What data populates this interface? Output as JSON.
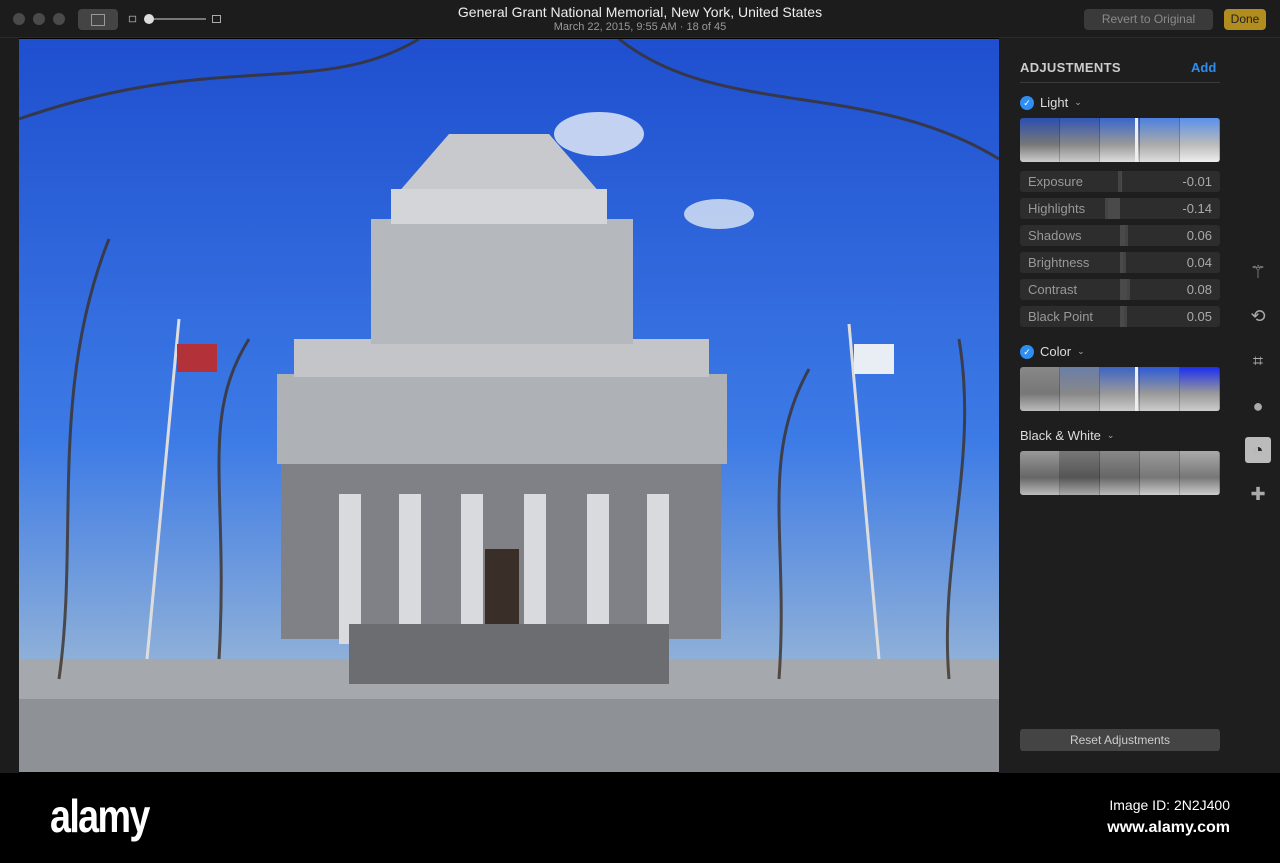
{
  "window": {
    "title": "General Grant National Memorial, New York, United States",
    "subtitle": "March 22, 2015, 9:55 AM  ·  18 of 45",
    "revert_label": "Revert to Original",
    "done_label": "Done"
  },
  "panel": {
    "heading": "ADJUSTMENTS",
    "add_label": "Add",
    "light": {
      "label": "Light",
      "sliders": [
        {
          "label": "Exposure",
          "value": -0.01
        },
        {
          "label": "Highlights",
          "value": -0.14
        },
        {
          "label": "Shadows",
          "value": 0.06
        },
        {
          "label": "Brightness",
          "value": 0.04
        },
        {
          "label": "Contrast",
          "value": 0.08
        },
        {
          "label": "Black Point",
          "value": 0.05
        }
      ]
    },
    "color": {
      "label": "Color"
    },
    "bw": {
      "label": "Black & White"
    },
    "reset_label": "Reset Adjustments"
  },
  "tools": [
    "magic-wand-icon",
    "rotate-icon",
    "crop-icon",
    "filters-icon",
    "adjust-icon",
    "retouch-icon"
  ],
  "footer": {
    "logo": "alamy",
    "image_id": "Image ID: 2N2J400",
    "site": "www.alamy.com"
  },
  "colors": {
    "accent": "#2f8ff0",
    "done": "#b18c1e"
  }
}
